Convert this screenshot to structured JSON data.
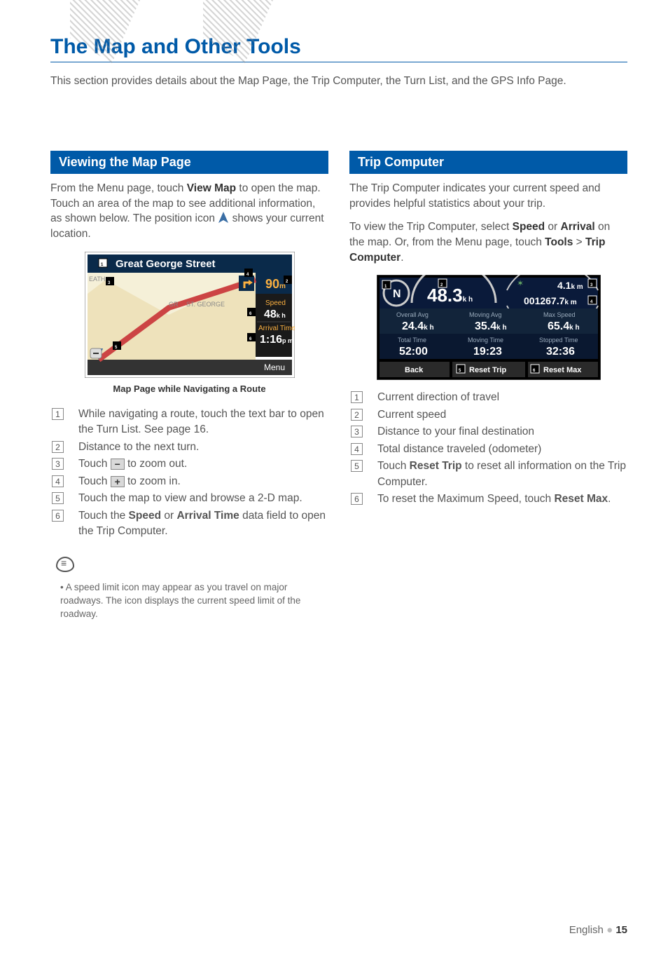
{
  "page_title": "The Map and Other Tools",
  "intro": "This section provides details about the Map Page, the Trip Computer, the Turn List, and the GPS Info Page.",
  "left": {
    "header": "Viewing the Map Page",
    "p1_a": "From the Menu page, touch ",
    "p1_b": "View Map",
    "p1_c": " to open the map. Touch an area of the map to see additional information, as shown below. The position icon ",
    "p1_d": " shows your current location.",
    "map_screenshot": {
      "street": "Great George Street",
      "distance": "90",
      "distance_unit": "m",
      "speed_label": "Speed",
      "speed_value": "48",
      "speed_unit": "k h",
      "arrival_label": "Arrival Time",
      "arrival_value": "1:16",
      "arrival_unit": "p m",
      "menu": "Menu",
      "map_label_1": "EATH",
      "map_label_2": "GR",
      "map_label_3": "ST. GEORGE",
      "callouts": {
        "1": "1",
        "2": "2",
        "3": "3",
        "4": "4",
        "5": "5",
        "6": "6"
      }
    },
    "caption": "Map Page while Navigating a Route",
    "items": [
      {
        "n": "1",
        "text_a": "While navigating a route, touch the text bar to open the Turn List. See page 16."
      },
      {
        "n": "2",
        "text_a": "Distance to the next turn."
      },
      {
        "n": "3",
        "text_a": "Touch ",
        "icon": "minus",
        "text_b": " to zoom out."
      },
      {
        "n": "4",
        "text_a": "Touch ",
        "icon": "plus",
        "text_b": " to zoom in."
      },
      {
        "n": "5",
        "text_a": "Touch the map to view and browse a 2-D map."
      },
      {
        "n": "6",
        "text_a": "Touch the ",
        "bold1": "Speed",
        "mid": " or ",
        "bold2": "Arrival Time",
        "text_b": " data field to open the Trip Computer."
      }
    ],
    "note": "A speed limit icon may appear as you travel on major roadways. The icon displays the current speed limit of the roadway."
  },
  "right": {
    "header": "Trip Computer",
    "p1": "The Trip Computer indicates your current speed and provides helpful statistics about your trip.",
    "p2_a": "To view the Trip Computer, select ",
    "p2_b": "Speed",
    "p2_c": " or ",
    "p2_d": "Arrival",
    "p2_e": " on the map. Or, from the Menu page, touch ",
    "p2_f": "Tools",
    "p2_g": " > ",
    "p2_h": "Trip Computer",
    "p2_i": ".",
    "tc_screenshot": {
      "dir": "N",
      "speed": "48.3",
      "speed_unit": "k h",
      "dist": "4.1",
      "dist_unit": "k m",
      "odo": "001267.7",
      "odo_unit": "k m",
      "overall_avg_lbl": "Overall Avg",
      "overall_avg": "24.4",
      "moving_avg_lbl": "Moving Avg",
      "moving_avg": "35.4",
      "max_speed_lbl": "Max Speed",
      "max_speed": "65.4",
      "kh": "k h",
      "total_time_lbl": "Total Time",
      "total_time": "52:00",
      "moving_time_lbl": "Moving Time",
      "moving_time": "19:23",
      "stopped_time_lbl": "Stopped Time",
      "stopped_time": "32:36",
      "back": "Back",
      "reset_trip": "Reset Trip",
      "reset_max": "Reset Max",
      "callouts": {
        "1": "1",
        "2": "2",
        "3": "3",
        "4": "4",
        "5": "5",
        "6": "6"
      }
    },
    "items": [
      {
        "n": "1",
        "text_a": "Current direction of travel"
      },
      {
        "n": "2",
        "text_a": "Current speed"
      },
      {
        "n": "3",
        "text_a": "Distance to your final destination"
      },
      {
        "n": "4",
        "text_a": "Total distance traveled (odometer)"
      },
      {
        "n": "5",
        "text_a": "Touch ",
        "bold1": "Reset Trip",
        "text_b": " to reset all information on the Trip Computer."
      },
      {
        "n": "6",
        "text_a": "To reset the Maximum Speed, touch ",
        "bold1": "Reset Max",
        "text_b": "."
      }
    ]
  },
  "footer": {
    "lang": "English",
    "page": "15"
  }
}
